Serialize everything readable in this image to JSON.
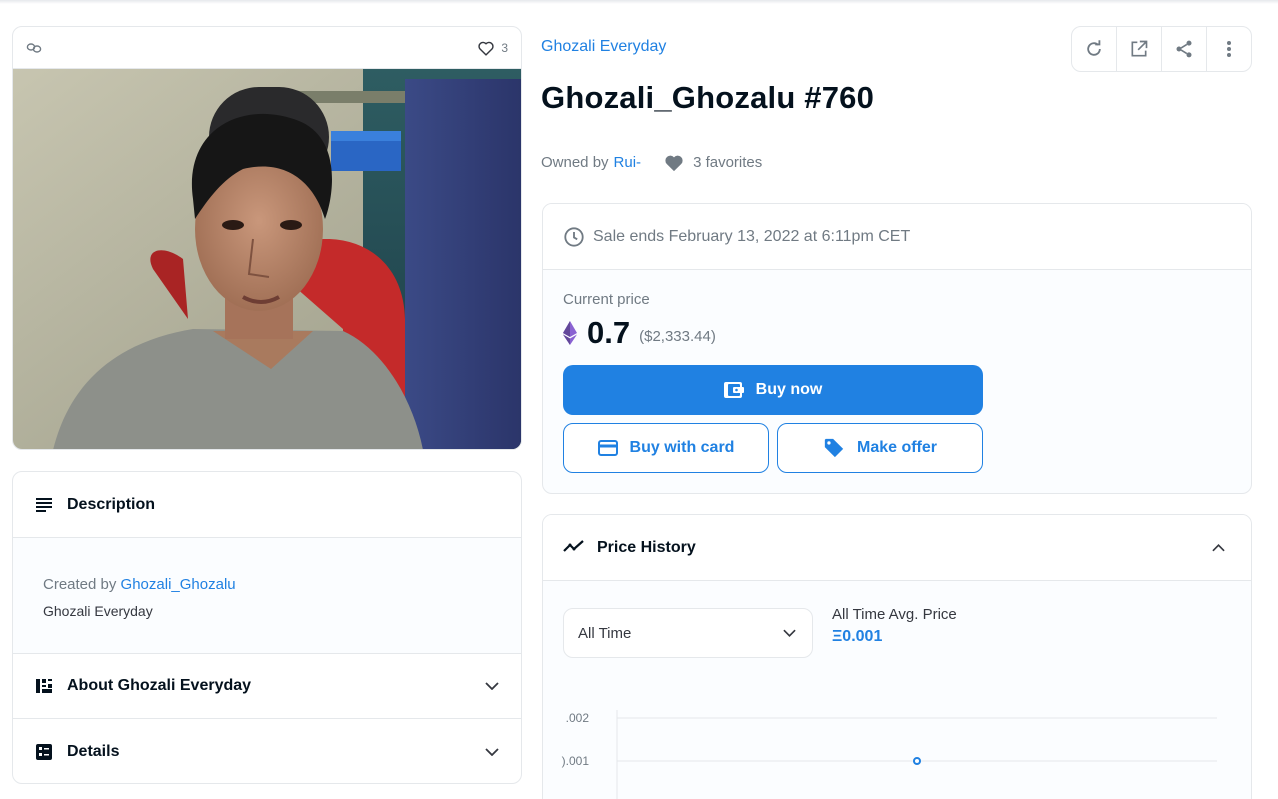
{
  "media": {
    "favorite_count": "3"
  },
  "description_panel": {
    "title": "Description",
    "created_by_prefix": "Created by",
    "creator": "Ghozali_Ghozalu",
    "collection_text": "Ghozali Everyday"
  },
  "about_panel": {
    "title": "About Ghozali Everyday"
  },
  "details_panel": {
    "title": "Details"
  },
  "item": {
    "collection": "Ghozali Everyday",
    "title": "Ghozali_Ghozalu #760",
    "owned_by_prefix": "Owned by",
    "owner": "Rui-",
    "favorites": "3 favorites"
  },
  "toolbar": {
    "icons": [
      "refresh-icon",
      "external-link-icon",
      "share-icon",
      "more-icon"
    ]
  },
  "sale": {
    "ends_text": "Sale ends February 13, 2022 at 6:11pm CET",
    "current_price_label": "Current price",
    "price": "0.7",
    "price_usd": "($2,333.44)",
    "buy_now_label": "Buy now",
    "buy_with_card_label": "Buy with card",
    "make_offer_label": "Make offer"
  },
  "price_history": {
    "title": "Price History",
    "period_value": "All Time",
    "avg_label": "All Time Avg. Price",
    "avg_value": "Ξ0.001"
  },
  "chart_data": {
    "type": "scatter",
    "ytick_labels": [
      ".002",
      ").001"
    ],
    "ylim": [
      0,
      0.002
    ],
    "points": [
      {
        "x": 0.5,
        "y": 0.001
      }
    ],
    "grid": true
  },
  "colors": {
    "accent": "#2081e2",
    "text_dark": "#04111d",
    "text_muted": "#707a83",
    "border": "#e5e8eb"
  }
}
